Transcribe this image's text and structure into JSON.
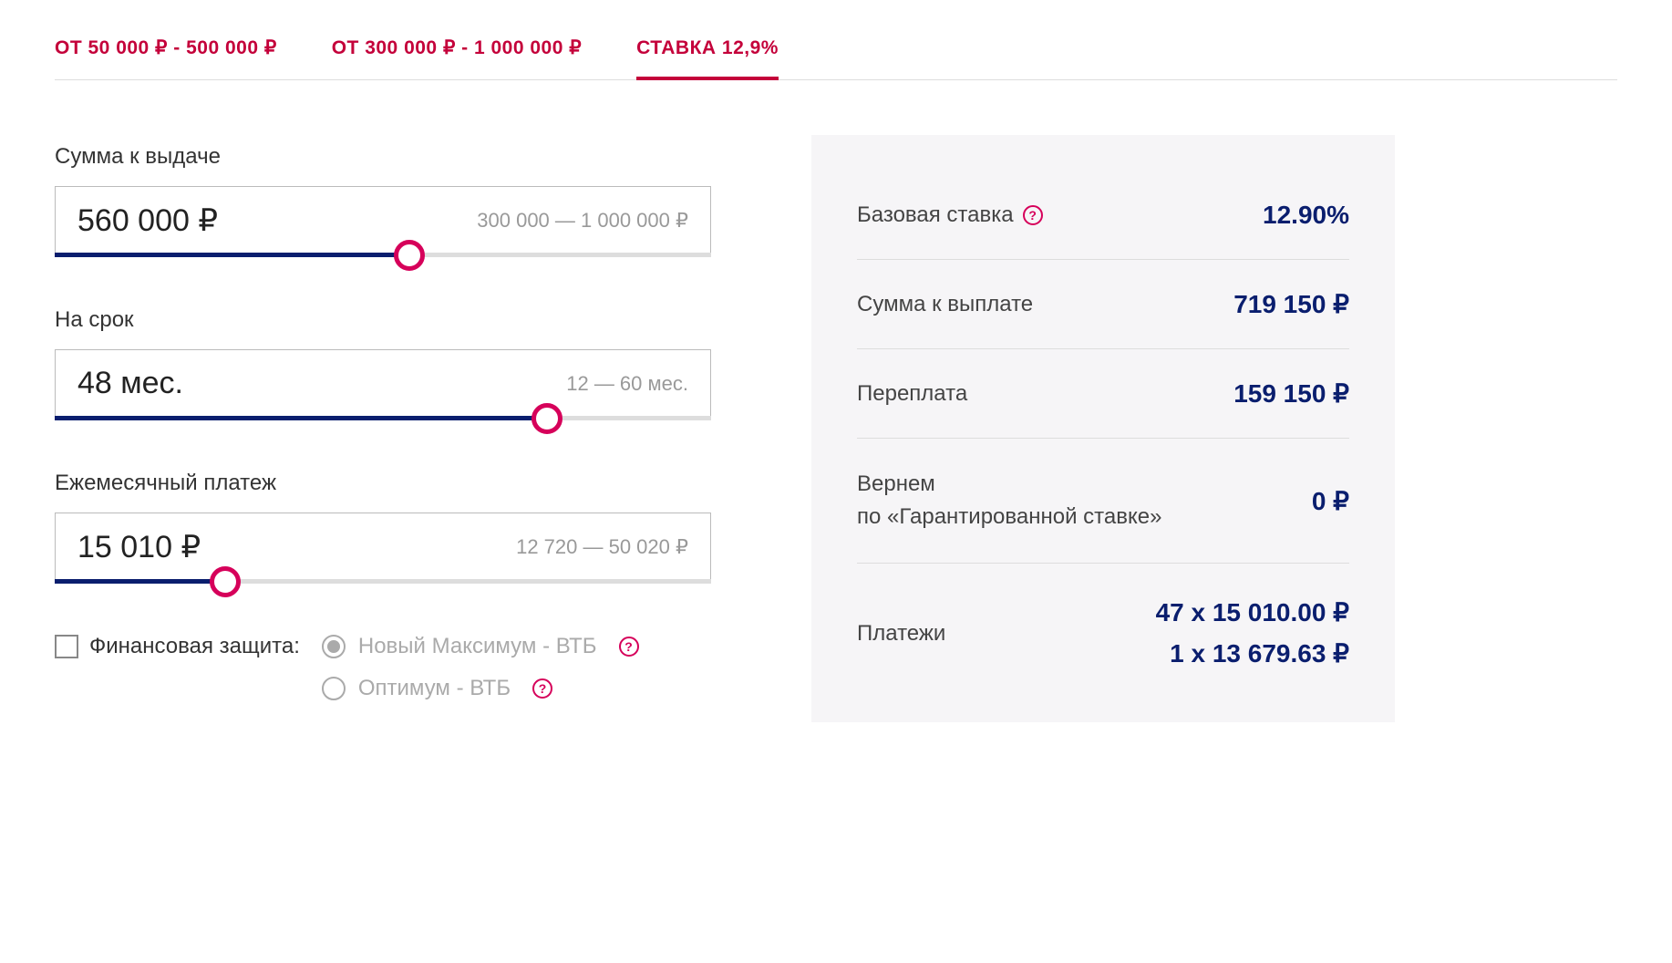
{
  "tabs": [
    {
      "label": "ОТ 50 000 ₽ - 500 000 ₽",
      "active": false
    },
    {
      "label": "ОТ 300 000 ₽ - 1 000 000 ₽",
      "active": false
    },
    {
      "label": "СТАВКА 12,9%",
      "active": true
    }
  ],
  "amount": {
    "label": "Сумма к выдаче",
    "value": "560 000 ₽",
    "hint": "300 000 — 1 000 000 ₽",
    "fill_percent": 54
  },
  "term": {
    "label": "На срок",
    "value": "48 мес.",
    "hint": "12 — 60 мес.",
    "fill_percent": 75
  },
  "payment": {
    "label": "Ежемесячный платеж",
    "value": "15 010 ₽",
    "hint": "12 720 — 50 020 ₽",
    "fill_percent": 26
  },
  "protection": {
    "label": "Финансовая защита:",
    "options": [
      {
        "label": "Новый Максимум - ВТБ",
        "checked": true
      },
      {
        "label": "Оптимум - ВТБ",
        "checked": false
      }
    ]
  },
  "summary": {
    "base_rate": {
      "label": "Базовая ставка",
      "value": "12.90%"
    },
    "total_payable": {
      "label": "Сумма к выплате",
      "value": "719 150 ₽"
    },
    "overpayment": {
      "label": "Переплата",
      "value": "159 150 ₽"
    },
    "cashback": {
      "label1": "Вернем",
      "label2": "по «Гарантированной ставке»",
      "value": "0 ₽"
    },
    "payments": {
      "label": "Платежи",
      "line1": "47 x 15 010.00 ₽",
      "line2": "1 x 13 679.63 ₽"
    }
  }
}
